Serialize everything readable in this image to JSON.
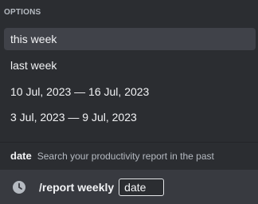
{
  "popup": {
    "header": "OPTIONS",
    "options": [
      {
        "label": "this week",
        "selected": true
      },
      {
        "label": "last week",
        "selected": false
      },
      {
        "label": "10 Jul, 2023 — 16 Jul, 2023",
        "selected": false
      },
      {
        "label": "3 Jul, 2023 — 9 Jul, 2023",
        "selected": false
      }
    ]
  },
  "hint": {
    "param_name": "date",
    "description": "Search your productivity report in the past"
  },
  "command_bar": {
    "icon": "clock-icon",
    "command": "/report weekly",
    "param_value": "date"
  },
  "colors": {
    "background": "#2b2d31",
    "selected": "#404249",
    "command_bar": "#383a40"
  }
}
